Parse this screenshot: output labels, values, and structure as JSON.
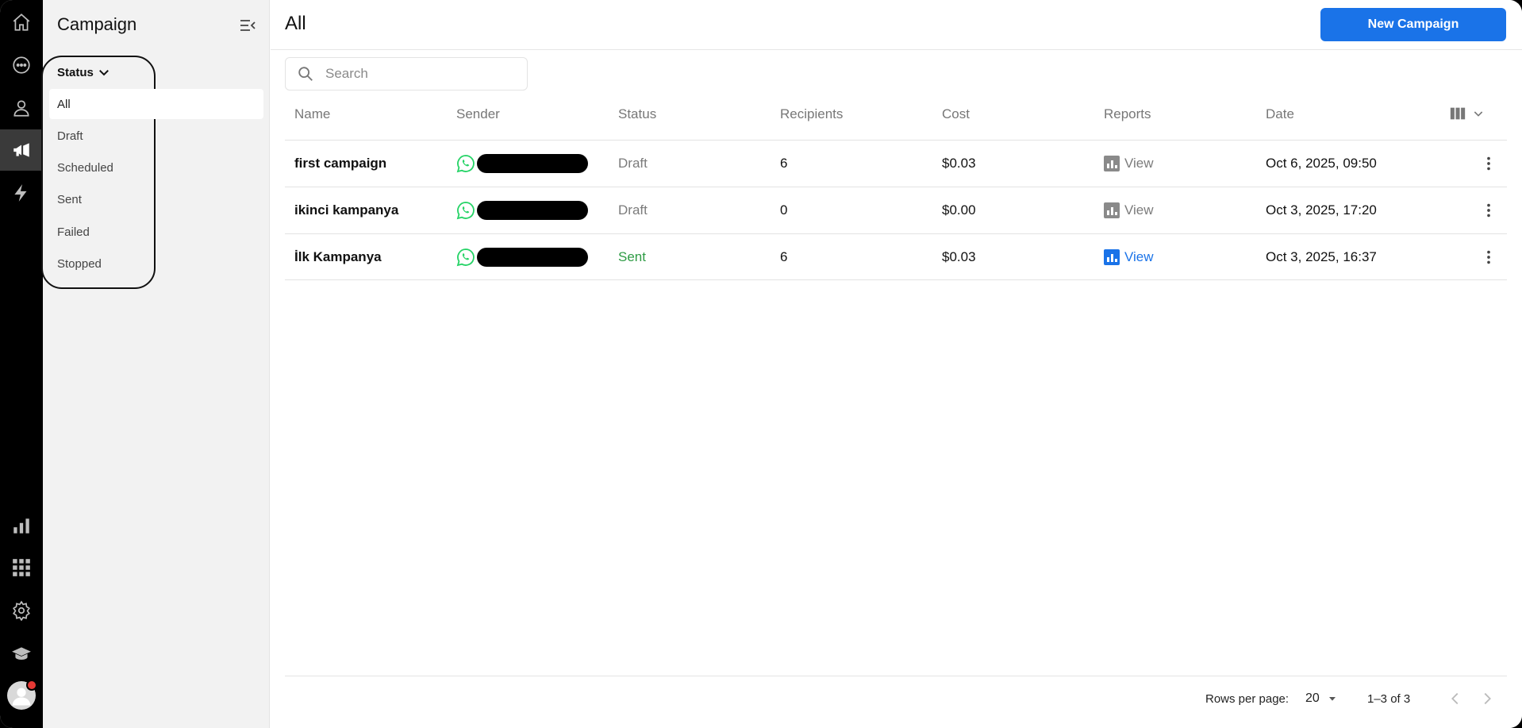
{
  "sidebar": {
    "title": "Campaign",
    "status_header": "Status",
    "filters": [
      "All",
      "Draft",
      "Scheduled",
      "Sent",
      "Failed",
      "Stopped"
    ],
    "selected_filter": "All"
  },
  "main": {
    "title": "All",
    "new_button": "New Campaign",
    "search_placeholder": "Search"
  },
  "table": {
    "columns": [
      "Name",
      "Sender",
      "Status",
      "Recipients",
      "Cost",
      "Reports",
      "Date"
    ],
    "rows": [
      {
        "name": "first campaign",
        "sender_icon": "whatsapp-icon",
        "status": "Draft",
        "recipients": "6",
        "cost": "$0.03",
        "reports": "View",
        "date": "Oct 6, 2025, 09:50"
      },
      {
        "name": "ikinci kampanya",
        "sender_icon": "whatsapp-icon",
        "status": "Draft",
        "recipients": "0",
        "cost": "$0.00",
        "reports": "View",
        "date": "Oct 3, 2025, 17:20"
      },
      {
        "name": "İlk Kampanya",
        "sender_icon": "whatsapp-icon",
        "status": "Sent",
        "recipients": "6",
        "cost": "$0.03",
        "reports": "View",
        "date": "Oct 3, 2025, 16:37"
      }
    ]
  },
  "footer": {
    "rows_per_page_label": "Rows per page:",
    "rows_per_page_value": "20",
    "range": "1–3 of 3"
  },
  "colors": {
    "accent": "#1a73e8",
    "sent": "#2e9b44",
    "draft": "#7b7b7b",
    "whatsapp": "#25d366"
  }
}
